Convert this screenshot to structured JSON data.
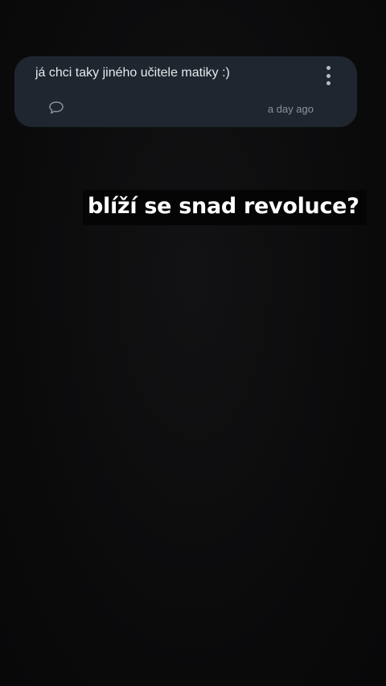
{
  "comment": {
    "text": "já chci taky jiného učitele matiky :)",
    "timestamp": "a day ago",
    "more_icon": "more-vertical-icon",
    "reply_icon": "speech-bubble-icon"
  },
  "caption": {
    "text": "blíží se snad revoluce?"
  },
  "colors": {
    "background": "#0b0b0c",
    "card": "#1f2630",
    "caption_bg": "#050505",
    "text_primary": "#e6e8ec",
    "text_muted": "#8b929c"
  }
}
